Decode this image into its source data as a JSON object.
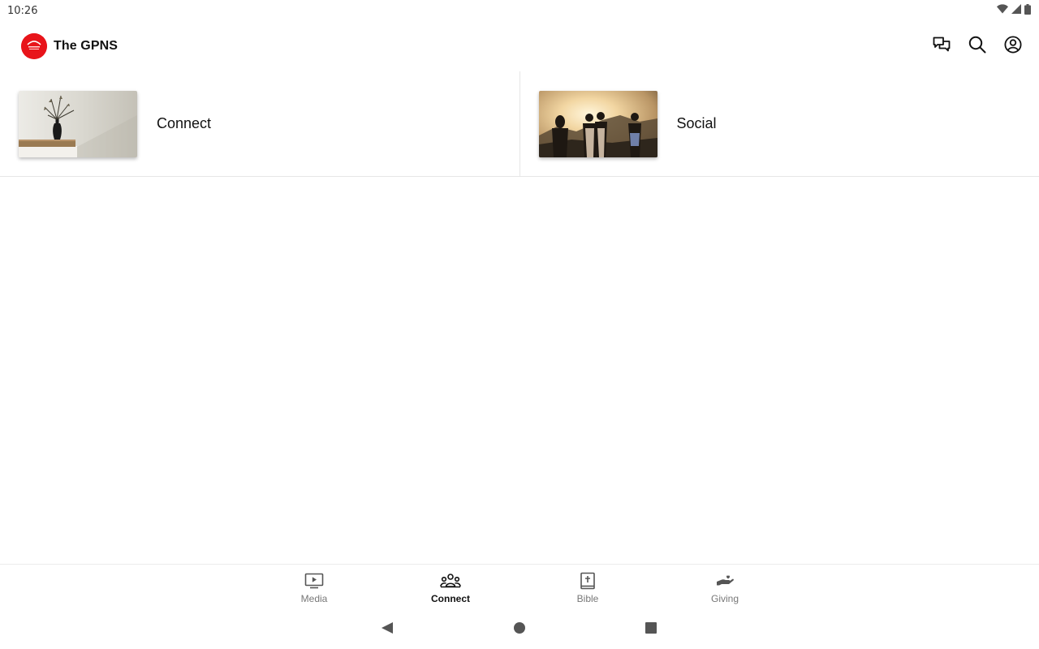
{
  "status_bar": {
    "time": "10:26",
    "icons": [
      "wifi-icon",
      "signal-icon",
      "battery-icon"
    ]
  },
  "app_bar": {
    "title": "The GPNS",
    "logo": "church-logo",
    "actions": [
      "chat-icon",
      "search-icon",
      "account-icon"
    ]
  },
  "cards": [
    {
      "label": "Connect",
      "thumbnail": "vase-on-shelf-photo"
    },
    {
      "label": "Social",
      "thumbnail": "friends-at-sunset-photo"
    }
  ],
  "bottom_nav": {
    "items": [
      {
        "label": "Media",
        "icon": "tv-play-icon"
      },
      {
        "label": "Connect",
        "icon": "people-group-icon"
      },
      {
        "label": "Bible",
        "icon": "bible-icon"
      },
      {
        "label": "Giving",
        "icon": "giving-hand-icon"
      }
    ],
    "active_index": 1
  },
  "system_nav": [
    "back-button",
    "home-button",
    "recents-button"
  ],
  "colors": {
    "brand_red": "#e8141a",
    "active_text": "#111111",
    "inactive_text": "#777777",
    "divider": "#e6e6e6"
  }
}
